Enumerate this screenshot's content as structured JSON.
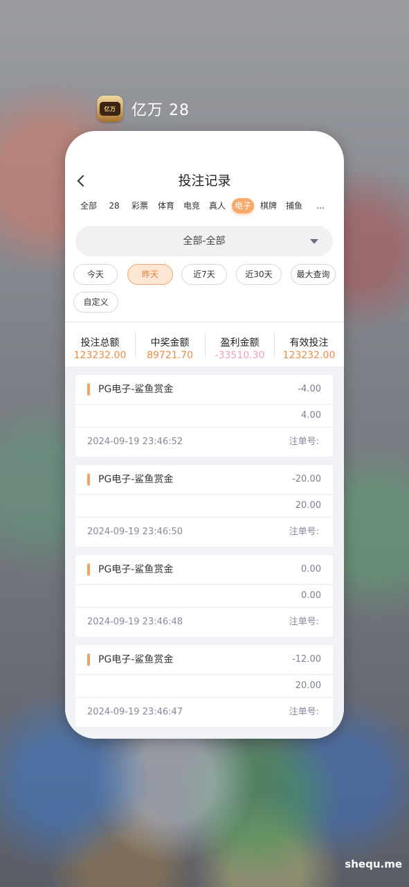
{
  "app": {
    "name": "亿万 28",
    "icon": "app-logo-icon"
  },
  "page": {
    "title": "投注记录",
    "back_icon": "chevron-left-icon"
  },
  "tabs": [
    "全部",
    "28",
    "彩票",
    "体育",
    "电竞",
    "真人",
    "电子",
    "棋牌",
    "捕鱼",
    "..."
  ],
  "active_tab": "电子",
  "filter": {
    "value": "全部-全部",
    "arrow_icon": "caret-down-icon"
  },
  "date_filters": [
    "今天",
    "昨天",
    "近7天",
    "近30天",
    "最大查询",
    "自定义"
  ],
  "active_date_filter": "昨天",
  "stats": [
    {
      "label": "投注总额",
      "value": "123232.00"
    },
    {
      "label": "中奖金额",
      "value": "89721.70"
    },
    {
      "label": "盈利金额",
      "value": "-33510.30"
    },
    {
      "label": "有效投注",
      "value": "123232.00"
    }
  ],
  "records": [
    {
      "name": "PG电子-鲨鱼赏金",
      "profit": "-4.00",
      "bet": "4.00",
      "time": "2024-09-19 23:46:52",
      "order_label": "注单号:"
    },
    {
      "name": "PG电子-鲨鱼赏金",
      "profit": "-20.00",
      "bet": "20.00",
      "time": "2024-09-19 23:46:50",
      "order_label": "注单号:"
    },
    {
      "name": "PG电子-鲨鱼赏金",
      "profit": "0.00",
      "bet": "0.00",
      "time": "2024-09-19 23:46:48",
      "order_label": "注单号:"
    },
    {
      "name": "PG电子-鲨鱼赏金",
      "profit": "-12.00",
      "bet": "20.00",
      "time": "2024-09-19 23:46:47",
      "order_label": "注单号:"
    }
  ],
  "watermark": "shequ.me",
  "colors": {
    "accent": "#f7a96c",
    "stat_value": "#f08a3f",
    "negative_value": "#f3a0b2"
  }
}
